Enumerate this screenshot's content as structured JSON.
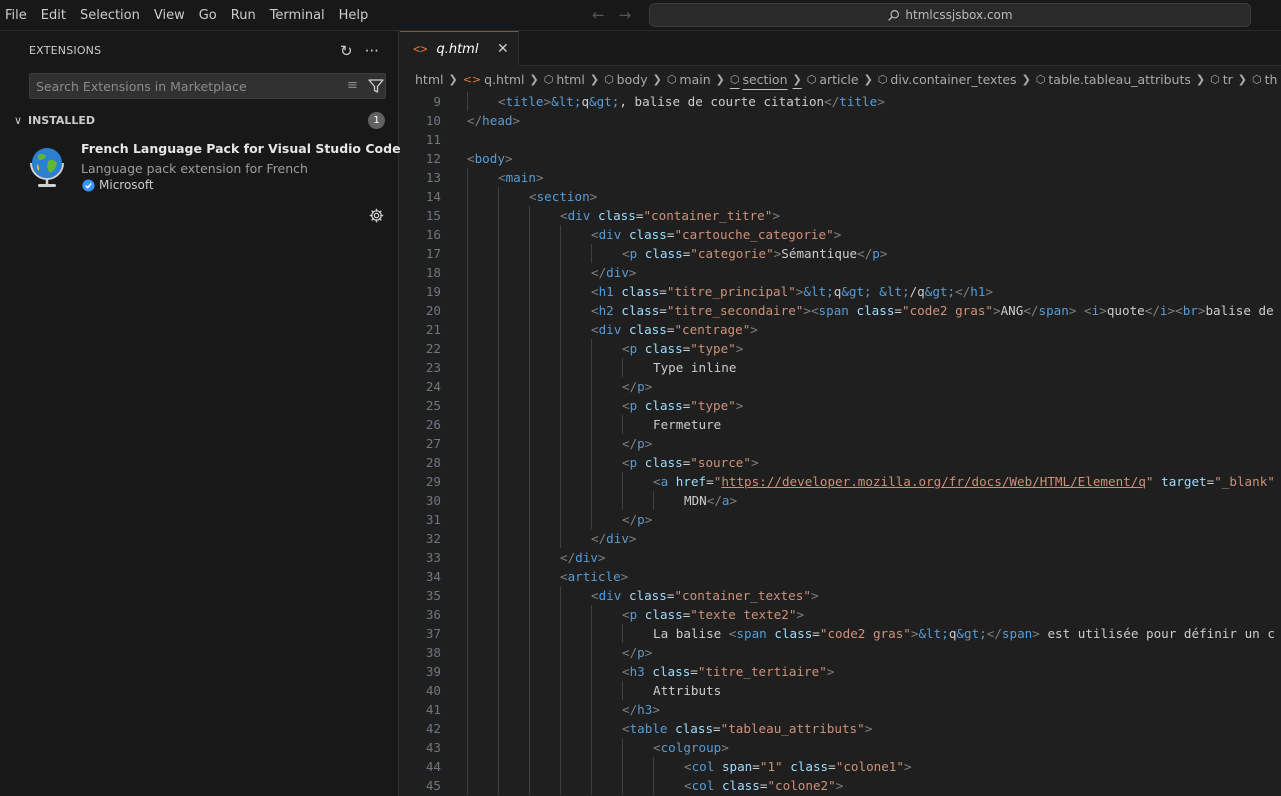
{
  "menu": [
    "File",
    "Edit",
    "Selection",
    "View",
    "Go",
    "Run",
    "Terminal",
    "Help"
  ],
  "command_center": "htmlcssjsbox.com",
  "sidebar": {
    "title": "EXTENSIONS",
    "search_placeholder": "Search Extensions in Marketplace",
    "installed_label": "INSTALLED",
    "installed_count": "1",
    "extension": {
      "name": "French Language Pack for Visual Studio Code",
      "description": "Language pack extension for French",
      "publisher": "Microsoft"
    }
  },
  "tab": {
    "name": "q.html"
  },
  "breadcrumb": [
    "html",
    "q.html",
    "html",
    "body",
    "main",
    "section",
    "article",
    "div.container_textes",
    "table.tableau_attributs",
    "tr",
    "th"
  ],
  "code_lines": [
    {
      "n": "9",
      "indent": 1,
      "tokens": [
        [
          "t",
          "<"
        ],
        [
          "n",
          "title"
        ],
        [
          "t",
          ">"
        ],
        [
          "e",
          "&lt;"
        ],
        [
          "x",
          "q"
        ],
        [
          "e",
          "&gt;"
        ],
        [
          "x",
          ", balise de courte citation"
        ],
        [
          "t",
          "</"
        ],
        [
          "n",
          "title"
        ],
        [
          "t",
          ">"
        ]
      ]
    },
    {
      "n": "10",
      "indent": 0,
      "tokens": [
        [
          "t",
          "</"
        ],
        [
          "n",
          "head"
        ],
        [
          "t",
          ">"
        ]
      ]
    },
    {
      "n": "11",
      "indent": 0,
      "tokens": []
    },
    {
      "n": "12",
      "indent": 0,
      "tokens": [
        [
          "t",
          "<"
        ],
        [
          "n",
          "body"
        ],
        [
          "t",
          ">"
        ]
      ]
    },
    {
      "n": "13",
      "indent": 1,
      "tokens": [
        [
          "t",
          "<"
        ],
        [
          "n",
          "main"
        ],
        [
          "t",
          ">"
        ]
      ]
    },
    {
      "n": "14",
      "indent": 2,
      "tokens": [
        [
          "t",
          "<"
        ],
        [
          "n",
          "section"
        ],
        [
          "t",
          ">"
        ]
      ]
    },
    {
      "n": "15",
      "indent": 3,
      "tokens": [
        [
          "t",
          "<"
        ],
        [
          "n",
          "div"
        ],
        [
          "x",
          " "
        ],
        [
          "a",
          "class"
        ],
        [
          "x",
          "="
        ],
        [
          "s",
          "\"container_titre\""
        ],
        [
          "t",
          ">"
        ]
      ]
    },
    {
      "n": "16",
      "indent": 4,
      "tokens": [
        [
          "t",
          "<"
        ],
        [
          "n",
          "div"
        ],
        [
          "x",
          " "
        ],
        [
          "a",
          "class"
        ],
        [
          "x",
          "="
        ],
        [
          "s",
          "\"cartouche_categorie\""
        ],
        [
          "t",
          ">"
        ]
      ]
    },
    {
      "n": "17",
      "indent": 5,
      "tokens": [
        [
          "t",
          "<"
        ],
        [
          "n",
          "p"
        ],
        [
          "x",
          " "
        ],
        [
          "a",
          "class"
        ],
        [
          "x",
          "="
        ],
        [
          "s",
          "\"categorie\""
        ],
        [
          "t",
          ">"
        ],
        [
          "x",
          "Sémantique"
        ],
        [
          "t",
          "</"
        ],
        [
          "n",
          "p"
        ],
        [
          "t",
          ">"
        ]
      ]
    },
    {
      "n": "18",
      "indent": 4,
      "tokens": [
        [
          "t",
          "</"
        ],
        [
          "n",
          "div"
        ],
        [
          "t",
          ">"
        ]
      ]
    },
    {
      "n": "19",
      "indent": 4,
      "tokens": [
        [
          "t",
          "<"
        ],
        [
          "n",
          "h1"
        ],
        [
          "x",
          " "
        ],
        [
          "a",
          "class"
        ],
        [
          "x",
          "="
        ],
        [
          "s",
          "\"titre_principal\""
        ],
        [
          "t",
          ">"
        ],
        [
          "e",
          "&lt;"
        ],
        [
          "x",
          "q"
        ],
        [
          "e",
          "&gt;"
        ],
        [
          "x",
          " "
        ],
        [
          "e",
          "&lt;"
        ],
        [
          "x",
          "/q"
        ],
        [
          "e",
          "&gt;"
        ],
        [
          "t",
          "</"
        ],
        [
          "n",
          "h1"
        ],
        [
          "t",
          ">"
        ]
      ]
    },
    {
      "n": "20",
      "indent": 4,
      "tokens": [
        [
          "t",
          "<"
        ],
        [
          "n",
          "h2"
        ],
        [
          "x",
          " "
        ],
        [
          "a",
          "class"
        ],
        [
          "x",
          "="
        ],
        [
          "s",
          "\"titre_secondaire\""
        ],
        [
          "t",
          ">"
        ],
        [
          "t",
          "<"
        ],
        [
          "n",
          "span"
        ],
        [
          "x",
          " "
        ],
        [
          "a",
          "class"
        ],
        [
          "x",
          "="
        ],
        [
          "s",
          "\"code2 gras\""
        ],
        [
          "t",
          ">"
        ],
        [
          "x",
          "ANG"
        ],
        [
          "t",
          "</"
        ],
        [
          "n",
          "span"
        ],
        [
          "t",
          ">"
        ],
        [
          "x",
          " "
        ],
        [
          "t",
          "<"
        ],
        [
          "n",
          "i"
        ],
        [
          "t",
          ">"
        ],
        [
          "x",
          "quote"
        ],
        [
          "t",
          "</"
        ],
        [
          "n",
          "i"
        ],
        [
          "t",
          ">"
        ],
        [
          "t",
          "<"
        ],
        [
          "n",
          "br"
        ],
        [
          "t",
          ">"
        ],
        [
          "x",
          "balise de"
        ]
      ]
    },
    {
      "n": "21",
      "indent": 4,
      "tokens": [
        [
          "t",
          "<"
        ],
        [
          "n",
          "div"
        ],
        [
          "x",
          " "
        ],
        [
          "a",
          "class"
        ],
        [
          "x",
          "="
        ],
        [
          "s",
          "\"centrage\""
        ],
        [
          "t",
          ">"
        ]
      ]
    },
    {
      "n": "22",
      "indent": 5,
      "tokens": [
        [
          "t",
          "<"
        ],
        [
          "n",
          "p"
        ],
        [
          "x",
          " "
        ],
        [
          "a",
          "class"
        ],
        [
          "x",
          "="
        ],
        [
          "s",
          "\"type\""
        ],
        [
          "t",
          ">"
        ]
      ]
    },
    {
      "n": "23",
      "indent": 6,
      "tokens": [
        [
          "x",
          "Type inline"
        ]
      ]
    },
    {
      "n": "24",
      "indent": 5,
      "tokens": [
        [
          "t",
          "</"
        ],
        [
          "n",
          "p"
        ],
        [
          "t",
          ">"
        ]
      ]
    },
    {
      "n": "25",
      "indent": 5,
      "tokens": [
        [
          "t",
          "<"
        ],
        [
          "n",
          "p"
        ],
        [
          "x",
          " "
        ],
        [
          "a",
          "class"
        ],
        [
          "x",
          "="
        ],
        [
          "s",
          "\"type\""
        ],
        [
          "t",
          ">"
        ]
      ]
    },
    {
      "n": "26",
      "indent": 6,
      "tokens": [
        [
          "x",
          "Fermeture"
        ]
      ]
    },
    {
      "n": "27",
      "indent": 5,
      "tokens": [
        [
          "t",
          "</"
        ],
        [
          "n",
          "p"
        ],
        [
          "t",
          ">"
        ]
      ]
    },
    {
      "n": "28",
      "indent": 5,
      "tokens": [
        [
          "t",
          "<"
        ],
        [
          "n",
          "p"
        ],
        [
          "x",
          " "
        ],
        [
          "a",
          "class"
        ],
        [
          "x",
          "="
        ],
        [
          "s",
          "\"source\""
        ],
        [
          "t",
          ">"
        ]
      ]
    },
    {
      "n": "29",
      "indent": 6,
      "tokens": [
        [
          "t",
          "<"
        ],
        [
          "n",
          "a"
        ],
        [
          "x",
          " "
        ],
        [
          "a",
          "href"
        ],
        [
          "x",
          "="
        ],
        [
          "s",
          "\""
        ],
        [
          "u",
          "https://developer.mozilla.org/fr/docs/Web/HTML/Element/q"
        ],
        [
          "s",
          "\""
        ],
        [
          "x",
          " "
        ],
        [
          "a",
          "target"
        ],
        [
          "x",
          "="
        ],
        [
          "s",
          "\"_blank\""
        ]
      ]
    },
    {
      "n": "30",
      "indent": 7,
      "tokens": [
        [
          "x",
          "MDN"
        ],
        [
          "t",
          "</"
        ],
        [
          "n",
          "a"
        ],
        [
          "t",
          ">"
        ]
      ]
    },
    {
      "n": "31",
      "indent": 5,
      "tokens": [
        [
          "t",
          "</"
        ],
        [
          "n",
          "p"
        ],
        [
          "t",
          ">"
        ]
      ]
    },
    {
      "n": "32",
      "indent": 4,
      "tokens": [
        [
          "t",
          "</"
        ],
        [
          "n",
          "div"
        ],
        [
          "t",
          ">"
        ]
      ]
    },
    {
      "n": "33",
      "indent": 3,
      "tokens": [
        [
          "t",
          "</"
        ],
        [
          "n",
          "div"
        ],
        [
          "t",
          ">"
        ]
      ]
    },
    {
      "n": "34",
      "indent": 3,
      "tokens": [
        [
          "t",
          "<"
        ],
        [
          "n",
          "article"
        ],
        [
          "t",
          ">"
        ]
      ]
    },
    {
      "n": "35",
      "indent": 4,
      "tokens": [
        [
          "t",
          "<"
        ],
        [
          "n",
          "div"
        ],
        [
          "x",
          " "
        ],
        [
          "a",
          "class"
        ],
        [
          "x",
          "="
        ],
        [
          "s",
          "\"container_textes\""
        ],
        [
          "t",
          ">"
        ]
      ]
    },
    {
      "n": "36",
      "indent": 5,
      "tokens": [
        [
          "t",
          "<"
        ],
        [
          "n",
          "p"
        ],
        [
          "x",
          " "
        ],
        [
          "a",
          "class"
        ],
        [
          "x",
          "="
        ],
        [
          "s",
          "\"texte texte2\""
        ],
        [
          "t",
          ">"
        ]
      ]
    },
    {
      "n": "37",
      "indent": 6,
      "tokens": [
        [
          "x",
          "La balise "
        ],
        [
          "t",
          "<"
        ],
        [
          "n",
          "span"
        ],
        [
          "x",
          " "
        ],
        [
          "a",
          "class"
        ],
        [
          "x",
          "="
        ],
        [
          "s",
          "\"code2 gras\""
        ],
        [
          "t",
          ">"
        ],
        [
          "e",
          "&lt;"
        ],
        [
          "x",
          "q"
        ],
        [
          "e",
          "&gt;"
        ],
        [
          "t",
          "</"
        ],
        [
          "n",
          "span"
        ],
        [
          "t",
          ">"
        ],
        [
          "x",
          " est utilisée pour définir un c"
        ]
      ]
    },
    {
      "n": "38",
      "indent": 5,
      "tokens": [
        [
          "t",
          "</"
        ],
        [
          "n",
          "p"
        ],
        [
          "t",
          ">"
        ]
      ]
    },
    {
      "n": "39",
      "indent": 5,
      "tokens": [
        [
          "t",
          "<"
        ],
        [
          "n",
          "h3"
        ],
        [
          "x",
          " "
        ],
        [
          "a",
          "class"
        ],
        [
          "x",
          "="
        ],
        [
          "s",
          "\"titre_tertiaire\""
        ],
        [
          "t",
          ">"
        ]
      ]
    },
    {
      "n": "40",
      "indent": 6,
      "tokens": [
        [
          "x",
          "Attributs"
        ]
      ]
    },
    {
      "n": "41",
      "indent": 5,
      "tokens": [
        [
          "t",
          "</"
        ],
        [
          "n",
          "h3"
        ],
        [
          "t",
          ">"
        ]
      ]
    },
    {
      "n": "42",
      "indent": 5,
      "tokens": [
        [
          "t",
          "<"
        ],
        [
          "n",
          "table"
        ],
        [
          "x",
          " "
        ],
        [
          "a",
          "class"
        ],
        [
          "x",
          "="
        ],
        [
          "s",
          "\"tableau_attributs\""
        ],
        [
          "t",
          ">"
        ]
      ]
    },
    {
      "n": "43",
      "indent": 6,
      "tokens": [
        [
          "t",
          "<"
        ],
        [
          "n",
          "colgroup"
        ],
        [
          "t",
          ">"
        ]
      ]
    },
    {
      "n": "44",
      "indent": 7,
      "tokens": [
        [
          "t",
          "<"
        ],
        [
          "n",
          "col"
        ],
        [
          "x",
          " "
        ],
        [
          "a",
          "span"
        ],
        [
          "x",
          "="
        ],
        [
          "s",
          "\"1\""
        ],
        [
          "x",
          " "
        ],
        [
          "a",
          "class"
        ],
        [
          "x",
          "="
        ],
        [
          "s",
          "\"colone1\""
        ],
        [
          "t",
          ">"
        ]
      ]
    },
    {
      "n": "45",
      "indent": 7,
      "tokens": [
        [
          "t",
          "<"
        ],
        [
          "n",
          "col"
        ],
        [
          "x",
          " "
        ],
        [
          "a",
          "class"
        ],
        [
          "x",
          "="
        ],
        [
          "s",
          "\"colone2\""
        ],
        [
          "t",
          ">"
        ]
      ]
    }
  ]
}
